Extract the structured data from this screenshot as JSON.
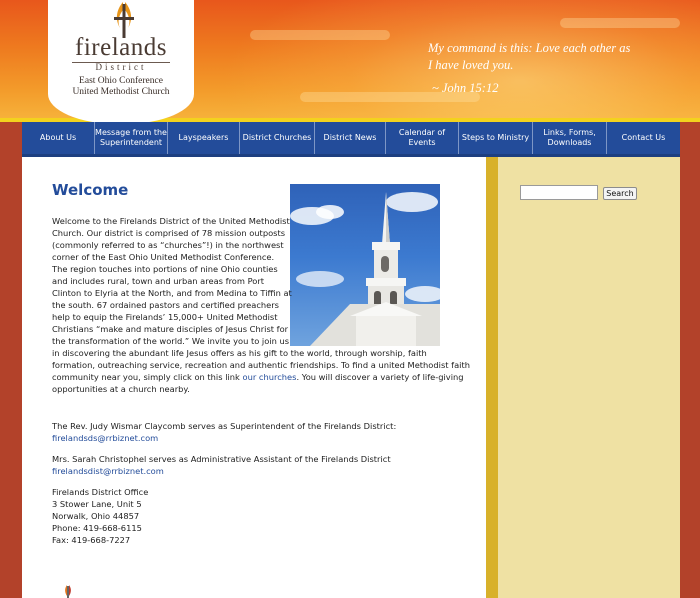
{
  "header": {
    "logo": {
      "brand": "firelands",
      "district": "District",
      "conference_line1": "East Ohio Conference",
      "conference_line2": "United Methodist Church"
    },
    "quote": {
      "line1": "My command is this: Love each other as",
      "line2": "I have loved you.",
      "reference": "~ John 15:12"
    }
  },
  "nav": {
    "items": [
      {
        "label": "About Us"
      },
      {
        "label": "Message from the Superintendent"
      },
      {
        "label": "Layspeakers"
      },
      {
        "label": "District Churches"
      },
      {
        "label": "District News"
      },
      {
        "label": "Calendar of Events"
      },
      {
        "label": "Steps to Ministry"
      },
      {
        "label": "Links, Forms, Downloads"
      },
      {
        "label": "Contact Us"
      }
    ]
  },
  "main": {
    "title": "Welcome",
    "intro_before_link": "Welcome to the Firelands District of the United Methodist Church. Our district is comprised of 78 mission outposts (commonly referred to as “churches”!) in the northwest corner of the East Ohio United Methodist Conference. The region touches into portions of nine Ohio counties and includes rural, town and urban areas from Port Clinton to Elyria at the North, and from Medina to Tiffin at the south. 67 ordained pastors and certified preachers help to equip the Firelands’ 15,000+ United Methodist Christians “make and mature disciples of Jesus Christ for the transformation of the world.” We invite you to join us in discovering the abundant life Jesus offers as his gift to the world, through worship, faith formation, outreaching service, recreation and authentic friendships. To find a united Methodist faith community near you, simply click on this link",
    "churches_link": "our churches",
    "intro_after_link": ". You will discover a variety of life-giving opportunities at a church nearby.",
    "superintendent_text": "The Rev. Judy Wismar Claycomb serves as Superintendent of the Firelands District:",
    "superintendent_email": "firelandsds@rrbiznet.com",
    "assistant_text": "Mrs. Sarah Christophel serves as Administrative Assistant of the Firelands District",
    "assistant_email": "firelandsdist@rrbiznet.com",
    "office": {
      "name": "Firelands District Office",
      "street": "3 Stower Lane, Unit 5",
      "city": "Norwalk, Ohio 44857",
      "phone": "Phone: 419-668-6115",
      "fax": "Fax: 419-668-7227"
    }
  },
  "sidebar": {
    "search_value": "",
    "search_button": "Search"
  },
  "colors": {
    "nav_blue": "#234c9a",
    "accent_gold": "#d8b12a",
    "sidebar_cream": "#efe1a3",
    "frame_red": "#b3422a",
    "header_orange": "#ee7a1f"
  }
}
